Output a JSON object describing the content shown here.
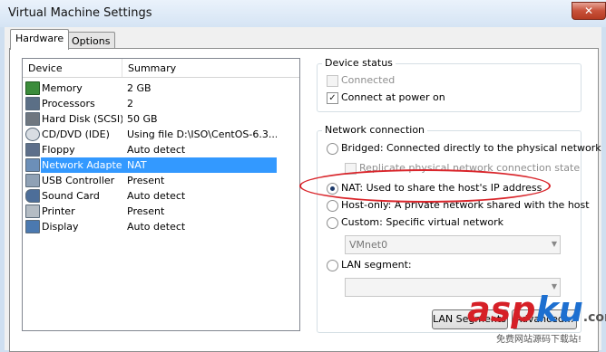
{
  "window": {
    "title": "Virtual Machine Settings",
    "close_glyph": "✕"
  },
  "tabs": [
    {
      "label": "Hardware",
      "active": true
    },
    {
      "label": "Options",
      "active": false
    }
  ],
  "device_list": {
    "headers": {
      "device": "Device",
      "summary": "Summary"
    },
    "rows": [
      {
        "name": "Memory",
        "summary": "2 GB",
        "icon": "memory-icon"
      },
      {
        "name": "Processors",
        "summary": "2",
        "icon": "processor-icon"
      },
      {
        "name": "Hard Disk (SCSI)",
        "summary": "50 GB",
        "icon": "hard-disk-icon"
      },
      {
        "name": "CD/DVD (IDE)",
        "summary": "Using file D:\\ISO\\CentOS-6.3...",
        "icon": "cd-dvd-icon"
      },
      {
        "name": "Floppy",
        "summary": "Auto detect",
        "icon": "floppy-icon"
      },
      {
        "name": "Network Adapter",
        "summary": "NAT",
        "icon": "network-adapter-icon",
        "selected": true
      },
      {
        "name": "USB Controller",
        "summary": "Present",
        "icon": "usb-icon"
      },
      {
        "name": "Sound Card",
        "summary": "Auto detect",
        "icon": "sound-card-icon"
      },
      {
        "name": "Printer",
        "summary": "Present",
        "icon": "printer-icon"
      },
      {
        "name": "Display",
        "summary": "Auto detect",
        "icon": "display-icon"
      }
    ]
  },
  "device_status": {
    "title": "Device status",
    "connected": {
      "label": "Connected",
      "checked": false,
      "enabled": false
    },
    "connect_at_power_on": {
      "label": "Connect at power on",
      "checked": true,
      "check_glyph": "✓"
    }
  },
  "network_connection": {
    "title": "Network connection",
    "options": {
      "bridged": {
        "label": "Bridged: Connected directly to the physical network",
        "checked": false
      },
      "replicate": {
        "label": "Replicate physical network connection state",
        "enabled": false
      },
      "nat": {
        "label": "NAT: Used to share the host's IP address",
        "checked": true
      },
      "host_only": {
        "label": "Host-only: A private network shared with the host",
        "checked": false
      },
      "custom": {
        "label": "Custom: Specific virtual network",
        "checked": false
      },
      "vmnet_select": {
        "value": "VMnet0"
      },
      "lan_segment": {
        "label": "LAN segment:",
        "checked": false
      },
      "lan_select": {
        "value": ""
      }
    }
  },
  "buttons": {
    "lan_segments": "LAN Segments...",
    "advanced": "Advanced..."
  },
  "arrow_glyph": "▼",
  "watermark": {
    "part1": "asp",
    "part2": "ku",
    "suffix": ".com",
    "subtitle": "免费网站源码下载站!"
  },
  "colors": {
    "selection": "#3399ff",
    "annotation": "#d9252b"
  }
}
